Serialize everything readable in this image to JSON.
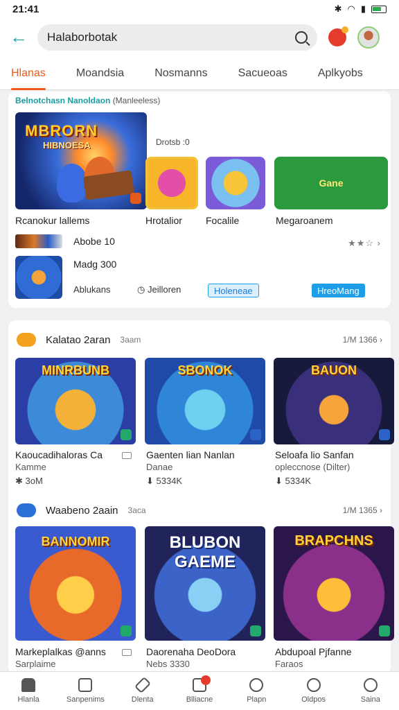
{
  "status": {
    "time": "21:41"
  },
  "search": {
    "value": "Halaborbotak"
  },
  "tabs": [
    {
      "label": "Hlanas",
      "active": true
    },
    {
      "label": "Moandsia"
    },
    {
      "label": "Nosmanns"
    },
    {
      "label": "Sacueoas"
    },
    {
      "label": "Aplkyobs"
    }
  ],
  "featured": {
    "title": "Belnotchasn Nanoldaon",
    "title_sub": "(Manleeless)",
    "big_art_title": "MBRORN",
    "big_art_sub": "HIBNOESA",
    "big_label": "Rcanokur lallems",
    "side_meta": "Drotsb :0",
    "tile_labels": [
      "Hrotalior",
      "Focalile",
      "Megaroanem"
    ],
    "green_tile_text": "Gane",
    "row1": "Abobe 10",
    "row2": "Madg 300",
    "meta_left": "Ablukans",
    "meta_mid": "Jeilloren",
    "pill1": "Holeneae",
    "pill2": "HreoMang",
    "stars": "★★☆ ›"
  },
  "section1": {
    "title": "Kalatao 2aran",
    "small": "3aam",
    "right": "1/M 1366 ›",
    "games": [
      {
        "art": "MINRBUNB",
        "name": "Kaoucadihaloras Ca",
        "sub": "Kamme",
        "size": "3oM"
      },
      {
        "art": "SBONOK",
        "name": "Gaenten lian Nanlan",
        "sub": "Danae",
        "size": "5334K"
      },
      {
        "art": "BAUON",
        "name": "Seloafa lio Sanfan",
        "sub": "opleccnose (Dilter)",
        "size": "5334K"
      }
    ]
  },
  "section2": {
    "title": "Waabeno 2aain",
    "small": "3aca",
    "right": "1/M 1365 ›",
    "games": [
      {
        "art": "BANNOMIR",
        "name": "Markeplalkas @anns",
        "sub": "Sarplaime"
      },
      {
        "art": "BLUBON GAEME",
        "name": "Daorenaha DeoDora",
        "sub": "Nebs 3330"
      },
      {
        "art": "BRAPCHNS",
        "name": "Abdupoal Pjfanne",
        "sub": "Faraos"
      }
    ]
  },
  "nav": [
    "Hlanla",
    "Sanpenims",
    "Dlenta",
    "Blliacne",
    "Plapn",
    "Oldpos",
    "Saina"
  ],
  "colors": {
    "accent": "#ef5a16",
    "teal": "#1a9ea0",
    "blue": "#1e9ee8"
  }
}
